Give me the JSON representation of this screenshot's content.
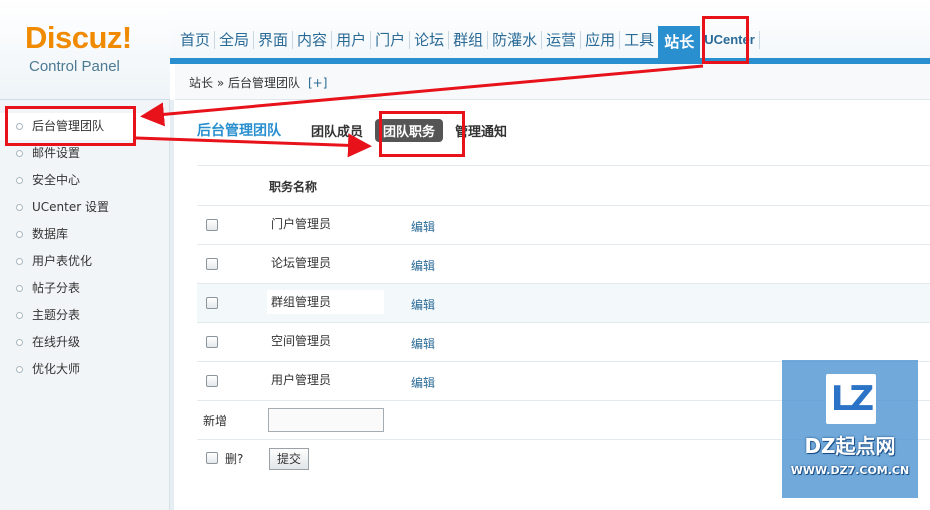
{
  "logo": {
    "brand": "Discuz",
    "exclaim": "!",
    "subtitle": "Control Panel"
  },
  "nav": {
    "items": [
      "首页",
      "全局",
      "界面",
      "内容",
      "用户",
      "门户",
      "论坛",
      "群组",
      "防灌水",
      "运营",
      "应用",
      "工具"
    ],
    "active": "站长",
    "ucenter": "UCenter"
  },
  "breadcrumb": {
    "text": "站长 » 后台管理团队",
    "add": "[+]"
  },
  "sidebar": {
    "items": [
      "后台管理团队",
      "邮件设置",
      "安全中心",
      "UCenter 设置",
      "数据库",
      "用户表优化",
      "帖子分表",
      "主题分表",
      "在线升级",
      "优化大师"
    ]
  },
  "tabs": {
    "title": "后台管理团队",
    "members": "团队成员",
    "duties": "团队职务",
    "notice": "管理通知"
  },
  "table": {
    "header": "职务名称",
    "edit_label": "编辑",
    "rows": [
      "门户管理员",
      "论坛管理员",
      "群组管理员",
      "空间管理员",
      "用户管理员"
    ]
  },
  "add": {
    "label": "新增"
  },
  "delete": {
    "label": "删?"
  },
  "submit": {
    "label": "提交"
  },
  "watermark": {
    "logo": "LZ",
    "title": "DZ起点网",
    "url": "WWW.DZ7.COM.CN"
  },
  "colors": {
    "accent": "#2a8fcf",
    "annotation": "#e8121b",
    "logo_orange": "#f08a00"
  }
}
